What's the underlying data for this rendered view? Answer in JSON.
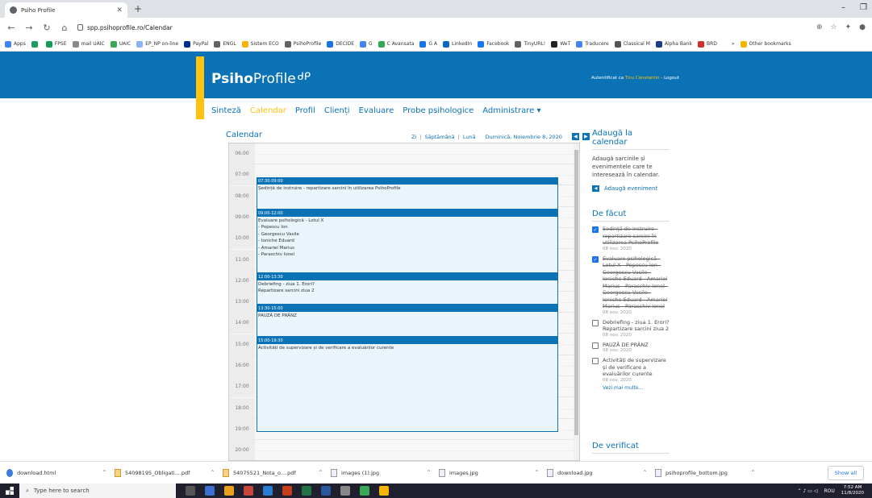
{
  "browser": {
    "tab_title": "Psiho Profile",
    "url": "spp.psihoprofile.ro/Calendar",
    "bookmarks": [
      "Apps",
      "",
      "FPSE",
      "mail UAIC",
      "UAIC",
      "EP_NP on-line",
      "PayPal",
      "ENGL",
      "Sistem ECO",
      "PsihoProfile",
      "DECIDE",
      "G",
      "C Avansata",
      "G A",
      "LinkedIn",
      "Facebook",
      "TinyURL!",
      "WeT",
      "Traducere",
      "Classical M",
      "Alpha Bank",
      "BRD",
      "»",
      "Other bookmarks"
    ]
  },
  "site": {
    "logo_bold": "Psiho",
    "logo_rest": "Profile",
    "auth_prefix": "Autentificat ca",
    "auth_user": "Ticu Constantin",
    "auth_suffix": "- Logout",
    "menu": [
      "Sinteză",
      "Calendar",
      "Profil",
      "Clienți",
      "Evaluare",
      "Probe psihologice",
      "Administrare ▾"
    ]
  },
  "calendar": {
    "title": "Calendar",
    "view_day": "Zi",
    "view_week": "Săptămână",
    "view_month": "Lună",
    "date": "Duminică, Noiembrie 8, 2020",
    "hours": [
      "06:00",
      "07:00",
      "08:00",
      "09:00",
      "10:00",
      "11:00",
      "12:00",
      "13:00",
      "14:00",
      "15:00",
      "16:00",
      "17:00",
      "18:00",
      "19:00",
      "20:00"
    ],
    "events": [
      {
        "time": "07:30-09:00",
        "text": "Ședință de instruire - repartizare sarcini în utilizarea PsihoProfile"
      },
      {
        "time": "09:00-12:00",
        "text": "Evaluare psihologică - Lotul X\n- Popescu Ion\n- Georgescu Vasile\n- Ioniche Eduard\n- Amariei Marius\n- Paraschiv Ionel"
      },
      {
        "time": "12:00-13:30",
        "text": "Debriefing - ziua 1. Erori?\nRepartizare sarcini ziua 2"
      },
      {
        "time": "13:30-15:00",
        "text": "PAUZĂ DE PRÂNZ"
      },
      {
        "time": "15:00-19:30",
        "text": "Activități de supervizare și de verificare a evaluărilor curente"
      }
    ]
  },
  "sidebar": {
    "add_title": "Adaugă la calendar",
    "add_desc": "Adaugă sarcinile și evenimentele care te interesează în calendar.",
    "add_event": "Adaugă eveniment",
    "todo_title": "De făcut",
    "todos": [
      {
        "text": "Ședință de instruire - repartizare sarcini în utilizarea PsihoProfile",
        "date": "08 nov. 2020",
        "done": true
      },
      {
        "text": "Evaluare psihologică - Lotul X - Popescu Ion - Georgescu Vasile - Ioniche Eduard - Amariei Marius - Paraschiv Ionel - Georgescu Vasile - Ioniche Eduard - Amariei Marius - Paraschiv Ionel",
        "date": "08 nov. 2020",
        "done": true
      },
      {
        "text": "Debriefing - ziua 1. Erori? Repartizare sarcini ziua 2",
        "date": "08 nov. 2020",
        "done": false
      },
      {
        "text": "PAUZĂ DE PRÂNZ",
        "date": "08 nov. 2020",
        "done": false
      },
      {
        "text": "Activități de supervizare și de verificare a evaluărilor curente",
        "date": "08 nov. 2020",
        "done": false
      }
    ],
    "more": "Vezi mai multe...",
    "verify_title": "De verificat"
  },
  "downloads": [
    {
      "name": "download.html",
      "kind": "html"
    },
    {
      "name": "54098195_Obligati....pdf",
      "kind": "pdf"
    },
    {
      "name": "54075521_Nota_o....pdf",
      "kind": "pdf"
    },
    {
      "name": "images (1).jpg",
      "kind": "img"
    },
    {
      "name": "images.jpg",
      "kind": "img"
    },
    {
      "name": "download.jpg",
      "kind": "img"
    },
    {
      "name": "psihoprofile_bottom.jpg",
      "kind": "img"
    }
  ],
  "show_all": "Show all",
  "taskbar": {
    "search_placeholder": "Type here to search",
    "lang": "ROU",
    "time": "7:52 AM",
    "date": "11/8/2020"
  }
}
